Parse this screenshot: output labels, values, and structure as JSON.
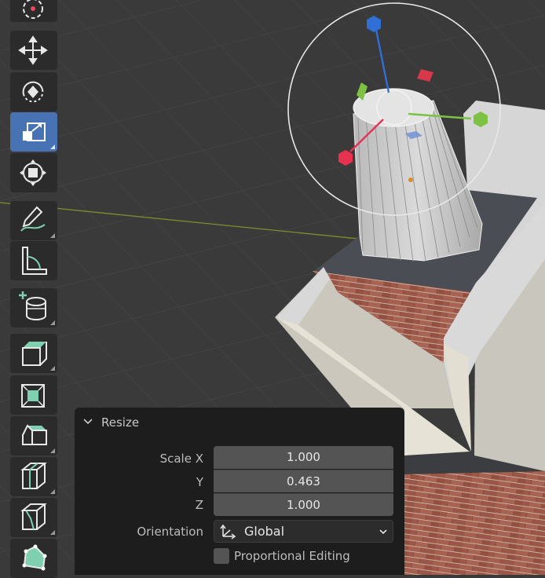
{
  "resize_panel": {
    "title": "Resize",
    "scale_x_label": "Scale X",
    "scale_x_value": "1.000",
    "scale_y_label": "Y",
    "scale_y_value": "0.463",
    "scale_z_label": "Z",
    "scale_z_value": "1.000",
    "orientation_label": "Orientation",
    "orientation_value": "Global",
    "proportional_label": "Proportional Editing",
    "proportional_checked": false
  },
  "toolbar": {
    "items": [
      {
        "icon": "cursor-icon"
      },
      {
        "icon": "move-icon"
      },
      {
        "icon": "rotate-icon"
      },
      {
        "icon": "scale-icon",
        "active": true
      },
      {
        "icon": "transform-icon"
      },
      {
        "icon": "annotate-icon"
      },
      {
        "icon": "measure-icon"
      },
      {
        "icon": "add-cylinder-icon"
      },
      {
        "icon": "extrude-region-icon"
      },
      {
        "icon": "inset-faces-icon"
      },
      {
        "icon": "bevel-icon"
      },
      {
        "icon": "loop-cut-icon"
      },
      {
        "icon": "knife-icon"
      },
      {
        "icon": "poly-build-icon"
      }
    ]
  },
  "colors": {
    "viewport_bg": "#3a3a3a",
    "active_tool": "#4772b3",
    "axis_x": "#e8314f",
    "axis_y": "#7dc242",
    "axis_z": "#2f6fd6",
    "panel_bg": "#1d1d1d",
    "field_bg": "#545454"
  }
}
